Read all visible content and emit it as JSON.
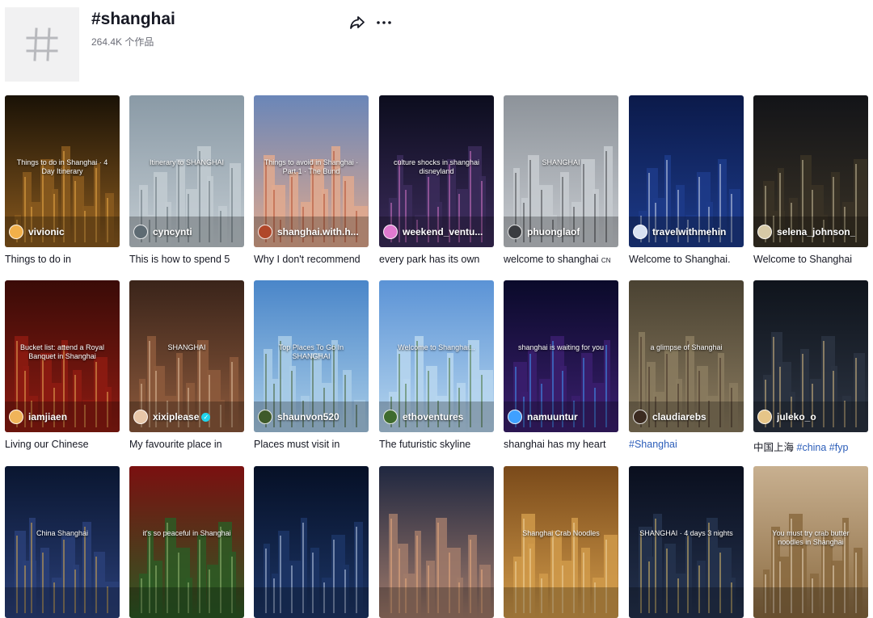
{
  "header": {
    "tag_icon": "hash-icon",
    "title": "#shanghai",
    "count": "264.4K 个作品",
    "share_icon": "share-arrow-icon",
    "more_icon": "more-horizontal-icon"
  },
  "colors": {
    "text": "#161823",
    "secondary": "#6b6d77",
    "hashtag": "#2b5db9",
    "verified": "#20d5ec"
  },
  "videos": [
    {
      "username": "vivionic",
      "caption": "Things to do in",
      "overlay": "Things to do in Shanghai · 4 Day Itinerary",
      "verified": false
    },
    {
      "username": "cyncynti",
      "caption": "This is how to spend 5",
      "overlay": "Itinerary to SHANGHAI",
      "verified": false
    },
    {
      "username": "shanghai.with.h...",
      "caption": "Why I don't recommend",
      "overlay": "Things to avoid in Shanghai · Part 1 · The Bund",
      "verified": false
    },
    {
      "username": "weekend_ventu...",
      "caption": "every park has its own",
      "overlay": "culture shocks in shanghai disneyland",
      "verified": false
    },
    {
      "username": "phuonglaof",
      "caption": "welcome to shanghai",
      "caption_suffix": "CN",
      "overlay": "SHANGHAI",
      "verified": false
    },
    {
      "username": "travelwithmehin",
      "caption": "Welcome to Shanghai.",
      "overlay": "",
      "verified": false
    },
    {
      "username": "selena_johnson_",
      "caption": "Welcome to Shanghai",
      "overlay": "",
      "verified": false
    },
    {
      "username": "iamjiaen",
      "caption": "Living our Chinese",
      "overlay": "Bucket list: attend a Royal Banquet in Shanghai",
      "verified": false
    },
    {
      "username": "xixiplease",
      "caption": "My favourite place in",
      "overlay": "SHANGHAI",
      "verified": true
    },
    {
      "username": "shaunvon520",
      "caption": "Places must visit in",
      "overlay": "Top Places To Go In SHANGHAI",
      "verified": false
    },
    {
      "username": "ethoventures",
      "caption": "The futuristic skyline",
      "overlay": "Welcome to Shanghai...",
      "verified": false
    },
    {
      "username": "namuuntur",
      "caption": "shanghai has my heart",
      "overlay": "shanghai is waiting for you",
      "verified": false
    },
    {
      "username": "claudiarebs",
      "caption_hashtag": "#Shanghai",
      "overlay": "a glimpse of Shanghai",
      "verified": false
    },
    {
      "username": "juleko_o",
      "caption": "中国上海",
      "caption_hashtag": "#china #fyp",
      "overlay": "",
      "verified": false
    },
    {
      "overlay": "China Shanghai"
    },
    {
      "overlay": "it's so peaceful in Shanghai"
    },
    {
      "overlay": ""
    },
    {
      "overlay": ""
    },
    {
      "overlay": "Shanghai Crab Noodles"
    },
    {
      "overlay": "SHANGHAI · 4 days 3 nights"
    },
    {
      "overlay": "You must try crab butter noodles in Shanghai"
    }
  ]
}
